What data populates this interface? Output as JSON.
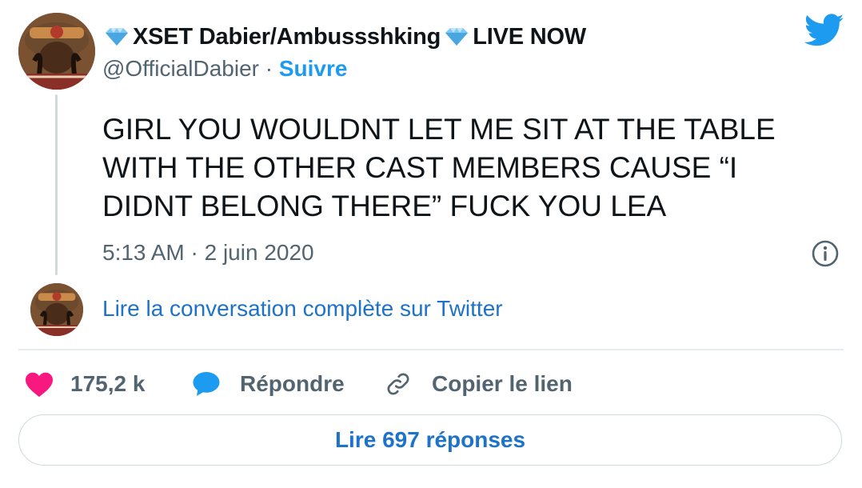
{
  "author": {
    "name_prefix_icon": "diamond-icon",
    "name": "XSET Dabier/Ambussshking",
    "name_suffix_icon": "diamond-icon",
    "name_suffix": "LIVE NOW",
    "handle": "@OfficialDabier",
    "separator": " · ",
    "follow_label": "Suivre"
  },
  "tweet": {
    "text": "GIRL YOU WOULDNT LET ME SIT AT THE TABLE WITH THE OTHER CAST MEMBERS CAUSE “I DIDNT BELONG THERE” FUCK YOU LEA",
    "timestamp": "5:13 AM · 2 juin 2020"
  },
  "conversation_link": "Lire la conversation complète sur Twitter",
  "actions": {
    "like_count": "175,2 k",
    "reply_label": "Répondre",
    "copy_link_label": "Copier le lien"
  },
  "replies_button": "Lire 697 réponses",
  "colors": {
    "accent_blue": "#1d9bf0",
    "link_blue": "#1d72c9",
    "heart_pink": "#f91880",
    "muted_text": "#536471",
    "diamond": "#7ec8f2"
  },
  "icons": [
    "twitter-bird-icon",
    "info-icon",
    "heart-icon",
    "reply-bubble-icon",
    "link-icon",
    "diamond-icon"
  ]
}
